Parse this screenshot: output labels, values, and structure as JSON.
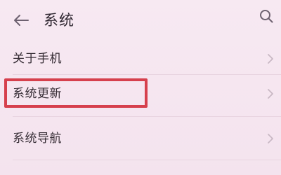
{
  "header": {
    "title": "系统",
    "back_icon": "back-arrow-icon",
    "search_icon": "search-icon"
  },
  "list": {
    "items": [
      {
        "label": "关于手机",
        "icon": "chevron-right-icon"
      },
      {
        "label": "系统更新",
        "icon": "chevron-right-icon"
      },
      {
        "label": "系统导航",
        "icon": "chevron-right-icon"
      }
    ]
  },
  "colors": {
    "background": "#f6e7f1",
    "highlight": "#d6404d",
    "chevron": "#c9b8c4"
  }
}
